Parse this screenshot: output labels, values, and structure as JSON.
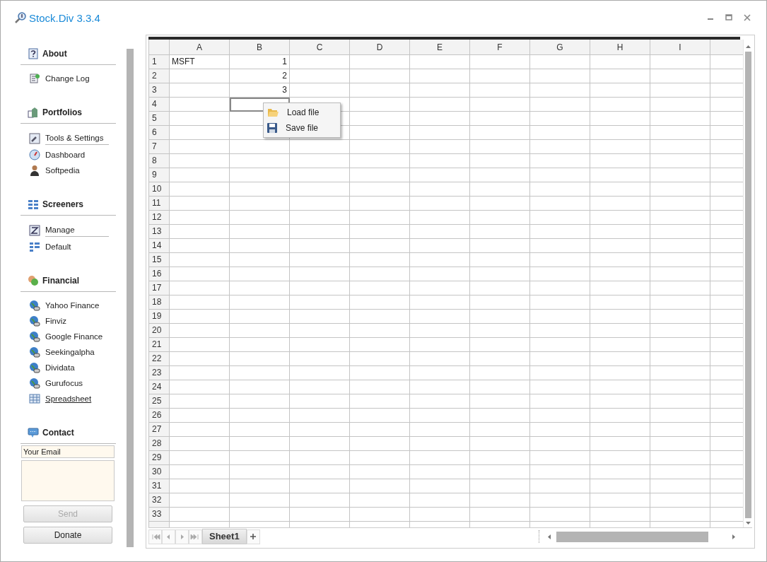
{
  "window": {
    "title": "Stock.Div 3.3.4"
  },
  "sidebar": {
    "sections": [
      {
        "title": "About",
        "items": [
          {
            "label": "Change Log",
            "selected": false,
            "rule_below": false
          }
        ]
      },
      {
        "title": "Portfolios",
        "items": [
          {
            "label": "Tools & Settings",
            "selected": false,
            "rule_below": true
          },
          {
            "label": "Dashboard",
            "selected": false,
            "rule_below": false
          },
          {
            "label": "Softpedia",
            "selected": false,
            "rule_below": false
          }
        ]
      },
      {
        "title": "Screeners",
        "items": [
          {
            "label": "Manage",
            "selected": false,
            "rule_below": true
          },
          {
            "label": "Default",
            "selected": false,
            "rule_below": false
          }
        ]
      },
      {
        "title": "Financial",
        "items": [
          {
            "label": "Yahoo Finance",
            "selected": false,
            "rule_below": false
          },
          {
            "label": "Finviz",
            "selected": false,
            "rule_below": false
          },
          {
            "label": "Google Finance",
            "selected": false,
            "rule_below": false
          },
          {
            "label": "Seekingalpha",
            "selected": false,
            "rule_below": false
          },
          {
            "label": "Dividata",
            "selected": false,
            "rule_below": false
          },
          {
            "label": "Gurufocus",
            "selected": false,
            "rule_below": false
          },
          {
            "label": "Spreadsheet",
            "selected": true,
            "rule_below": false
          }
        ]
      }
    ],
    "contact": {
      "title": "Contact",
      "email": {
        "placeholder": "Your Email"
      },
      "send": {
        "label": "Send",
        "disabled": true
      },
      "donate": {
        "label": "Donate",
        "disabled": false
      }
    }
  },
  "spreadsheet": {
    "columns": [
      "A",
      "B",
      "C",
      "D",
      "E",
      "F",
      "G",
      "H",
      "I"
    ],
    "rows": [
      {
        "label": "1",
        "cells": [
          {
            "text": "MSFT",
            "selected": false
          },
          {
            "text": "1",
            "selected": false
          }
        ]
      },
      {
        "label": "2",
        "cells": [
          {
            "selected": false
          },
          {
            "text": "2",
            "selected": false
          }
        ]
      },
      {
        "label": "3",
        "cells": [
          {
            "selected": false
          },
          {
            "text": "3",
            "selected": false
          }
        ]
      },
      {
        "label": "4",
        "cells": [
          {
            "selected": false
          },
          {
            "selected": true
          }
        ]
      },
      {
        "label": "5"
      },
      {
        "label": "6"
      },
      {
        "label": "7"
      },
      {
        "label": "8"
      },
      {
        "label": "9"
      },
      {
        "label": "10"
      },
      {
        "label": "11"
      },
      {
        "label": "12"
      },
      {
        "label": "13"
      },
      {
        "label": "14"
      },
      {
        "label": "15"
      },
      {
        "label": "16"
      },
      {
        "label": "17"
      },
      {
        "label": "18"
      },
      {
        "label": "19"
      },
      {
        "label": "20"
      },
      {
        "label": "21"
      },
      {
        "label": "22"
      },
      {
        "label": "23"
      },
      {
        "label": "24"
      },
      {
        "label": "25"
      },
      {
        "label": "26"
      },
      {
        "label": "27"
      },
      {
        "label": "28"
      },
      {
        "label": "29"
      },
      {
        "label": "30"
      },
      {
        "label": "31"
      },
      {
        "label": "32"
      },
      {
        "label": "33"
      }
    ],
    "context_menu": [
      {
        "label": "Load file"
      },
      {
        "label": "Save file"
      }
    ],
    "sheet_tabs": [
      {
        "label": "Sheet1",
        "selected": true
      }
    ]
  }
}
